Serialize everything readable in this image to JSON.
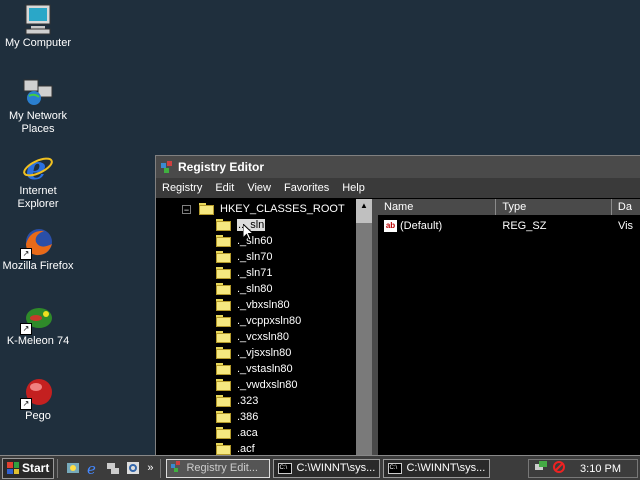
{
  "desktop": {
    "icons": [
      {
        "label": "My Computer",
        "icon": "my-computer-icon"
      },
      {
        "label": "My Network Places",
        "icon": "network-places-icon"
      },
      {
        "label": "Internet Explorer",
        "icon": "internet-explorer-icon"
      },
      {
        "label": "Mozilla Firefox",
        "icon": "firefox-icon"
      },
      {
        "label": "K-Meleon 74",
        "icon": "k-meleon-icon"
      },
      {
        "label": "Pego",
        "icon": "pego-icon"
      }
    ]
  },
  "window": {
    "title": "Registry Editor",
    "menu": [
      "Registry",
      "Edit",
      "View",
      "Favorites",
      "Help"
    ]
  },
  "tree": {
    "root": "HKEY_CLASSES_ROOT",
    "root_expander": "−",
    "items": [
      ".._sln",
      "._sln60",
      "._sln70",
      "._sln71",
      "._sln80",
      "._vbxsln80",
      "._vcppxsln80",
      "._vcxsln80",
      "._vjsxsln80",
      "._vstasln80",
      "._vwdxsln80",
      ".323",
      ".386",
      ".aca",
      ".acf"
    ],
    "selected_index": 0
  },
  "list": {
    "columns": [
      "Name",
      "Type",
      "Da"
    ],
    "rows": [
      {
        "name": "(Default)",
        "type": "REG_SZ",
        "data": "Vis"
      }
    ]
  },
  "taskbar": {
    "start_label": "Start",
    "quick_launch_overflow": "»",
    "tasks": [
      {
        "label": "Registry Edit...",
        "active": true
      },
      {
        "label": "C:\\WINNT\\sys...",
        "active": false
      },
      {
        "label": "C:\\WINNT\\sys...",
        "active": false
      }
    ],
    "clock": "3:10 PM"
  },
  "colors": {
    "desktop": "#1f2f3d",
    "titlebar": "#4a4a4a",
    "selection": "#dcdcdc"
  }
}
